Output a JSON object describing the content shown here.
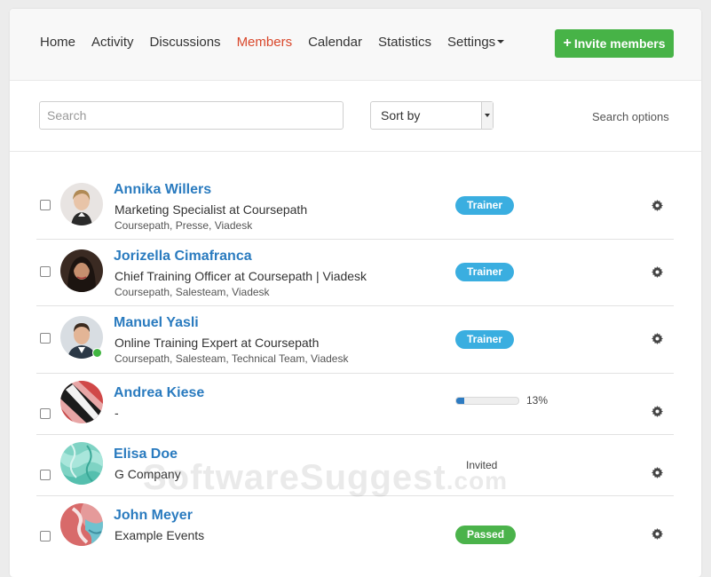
{
  "nav": {
    "items": [
      {
        "label": "Home",
        "active": false
      },
      {
        "label": "Activity",
        "active": false
      },
      {
        "label": "Discussions",
        "active": false
      },
      {
        "label": "Members",
        "active": true
      },
      {
        "label": "Calendar",
        "active": false
      },
      {
        "label": "Statistics",
        "active": false
      },
      {
        "label": "Settings",
        "active": false,
        "dropdown": true
      }
    ],
    "invite_label": "Invite members"
  },
  "toolbar": {
    "search_placeholder": "Search",
    "sort_label": "Sort by",
    "search_options_label": "Search options"
  },
  "members": [
    {
      "name": "Annika Willers",
      "title": "Marketing Specialist at Coursepath",
      "groups": "Coursepath, Presse, Viadesk",
      "status": {
        "type": "badge",
        "label": "Trainer",
        "color": "#3aaee0"
      },
      "online": false,
      "avatar": "portrait-woman-blonde"
    },
    {
      "name": "Jorizella Cimafranca",
      "title": "Chief Training Officer at Coursepath | Viadesk",
      "groups": "Coursepath, Salesteam, Viadesk",
      "status": {
        "type": "badge",
        "label": "Trainer",
        "color": "#3aaee0"
      },
      "online": false,
      "avatar": "portrait-woman-dark-hair"
    },
    {
      "name": "Manuel Yasli",
      "title": "Online Training Expert at Coursepath",
      "groups": "Coursepath, Salesteam, Technical Team, Viadesk",
      "status": {
        "type": "badge",
        "label": "Trainer",
        "color": "#3aaee0"
      },
      "online": true,
      "avatar": "portrait-man-suit"
    },
    {
      "name": "Andrea Kiese",
      "title": "-",
      "groups": "",
      "status": {
        "type": "progress",
        "label": "13%",
        "value": 0.13
      },
      "online": false,
      "avatar": "abstract-red-pattern"
    },
    {
      "name": "Elisa Doe",
      "title": "G Company",
      "groups": "",
      "status": {
        "type": "text",
        "label": "Invited"
      },
      "online": false,
      "avatar": "abstract-teal-pattern"
    },
    {
      "name": "John Meyer",
      "title": "Example Events",
      "groups": "",
      "status": {
        "type": "badge",
        "label": "Passed",
        "color": "#4bb34b"
      },
      "online": false,
      "avatar": "abstract-red-teal-pattern"
    }
  ],
  "watermark": {
    "main": "SoftwareSuggest",
    "suffix": ".com"
  },
  "colors": {
    "link": "#2a7bbf",
    "active_nav": "#d9472b",
    "invite_button": "#47b347",
    "trainer_badge": "#3aaee0",
    "passed_badge": "#4bb34b",
    "progress": "#2d7bc1"
  }
}
